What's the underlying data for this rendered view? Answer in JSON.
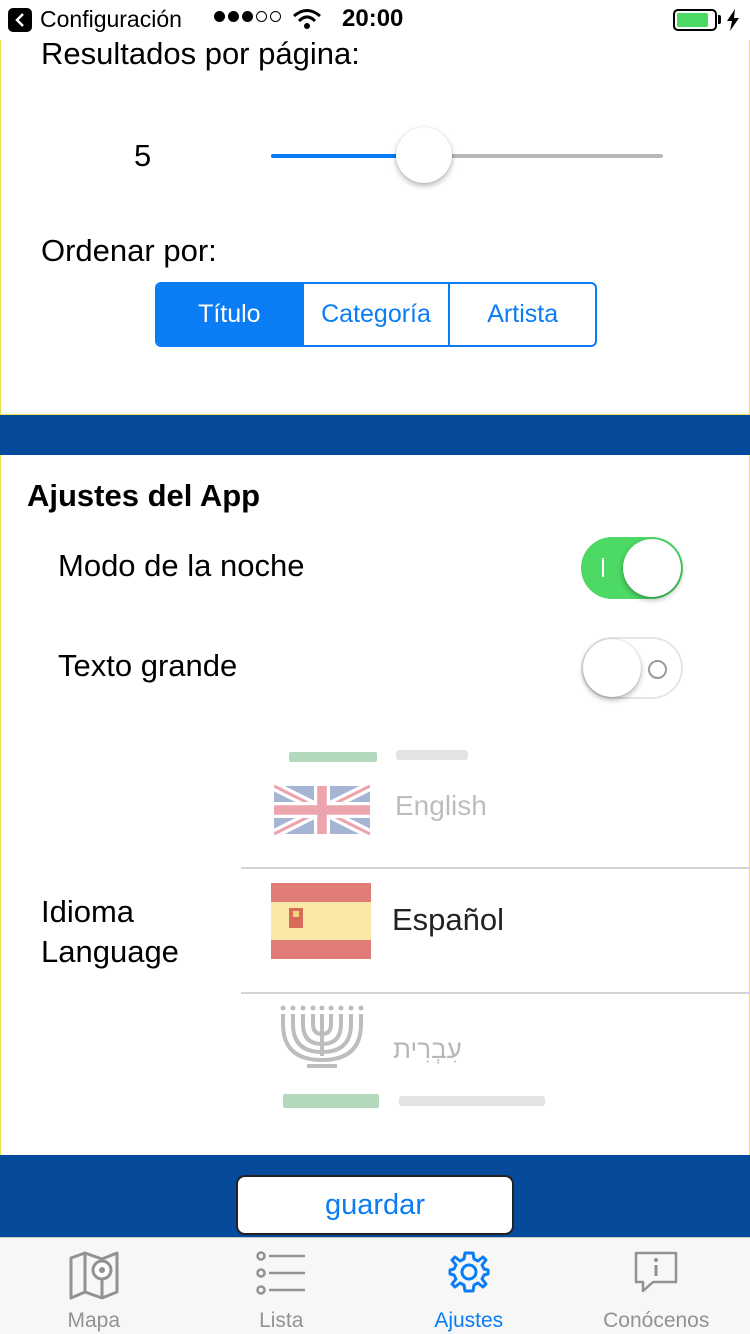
{
  "status_bar": {
    "back_label": "Configuración",
    "time": "20:00",
    "signal_bars": 3,
    "signal_total": 5,
    "battery_level": 0.85
  },
  "search_settings": {
    "results_label": "Resultados por página:",
    "results_value": "5",
    "slider_fraction": 0.39,
    "sort_label": "Ordenar por:",
    "sort_options": [
      "Título",
      "Categoría",
      "Artista"
    ],
    "sort_selected": 0
  },
  "app_settings": {
    "title": "Ajustes del App",
    "night_mode_label": "Modo de la noche",
    "night_mode_on": true,
    "large_text_label": "Texto grande",
    "large_text_on": false
  },
  "language": {
    "label_es": "Idioma",
    "label_en": "Language",
    "options": [
      {
        "name": "English",
        "icon": "uk-flag-icon"
      },
      {
        "name": "Español",
        "icon": "spain-flag-icon"
      },
      {
        "name": "עִבְרִית",
        "icon": "menorah-icon"
      }
    ],
    "selected": "Español"
  },
  "save_button": "guardar",
  "tab_bar": {
    "tabs": [
      {
        "label": "Mapa",
        "icon": "map-icon"
      },
      {
        "label": "Lista",
        "icon": "list-icon"
      },
      {
        "label": "Ajustes",
        "icon": "gear-icon"
      },
      {
        "label": "Conócenos",
        "icon": "info-bubble-icon"
      }
    ],
    "active": 2
  },
  "colors": {
    "accent": "#0a7cf4",
    "band": "#064a9b",
    "switch_on": "#4cd964",
    "card_border": "#e8e04a"
  }
}
